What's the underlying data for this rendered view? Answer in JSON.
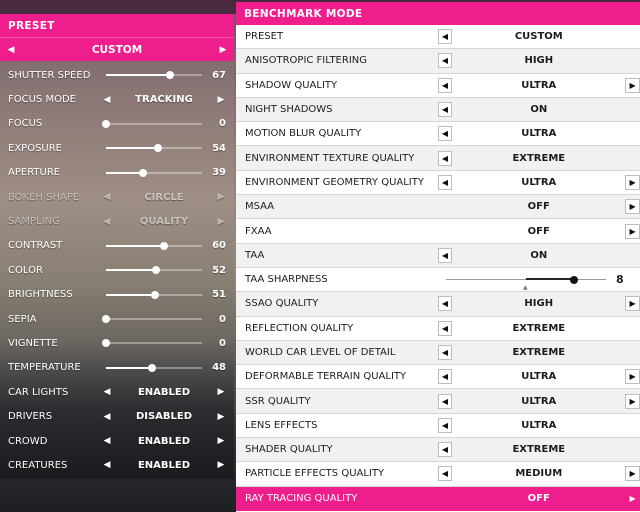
{
  "colors": {
    "accent": "#ee1e8c",
    "panel_bg": "#ffffff",
    "row_alt": "#f1f1f1"
  },
  "photo_panel": {
    "title": "PRESET",
    "preset_value": "CUSTOM",
    "rows": [
      {
        "label": "SHUTTER SPEED",
        "type": "slider",
        "value": "67",
        "level": 0.67
      },
      {
        "label": "FOCUS MODE",
        "type": "choice",
        "value": "TRACKING"
      },
      {
        "label": "FOCUS",
        "type": "slider",
        "value": "0",
        "level": 0.0
      },
      {
        "label": "EXPOSURE",
        "type": "slider",
        "value": "54",
        "level": 0.54
      },
      {
        "label": "APERTURE",
        "type": "slider",
        "value": "39",
        "level": 0.39
      },
      {
        "label": "BOKEH SHAPE",
        "type": "choice",
        "value": "CIRCLE",
        "disabled": true
      },
      {
        "label": "SAMPLING",
        "type": "choice",
        "value": "QUALITY",
        "disabled": true
      },
      {
        "label": "CONTRAST",
        "type": "slider",
        "value": "60",
        "level": 0.6
      },
      {
        "label": "COLOR",
        "type": "slider",
        "value": "52",
        "level": 0.52
      },
      {
        "label": "BRIGHTNESS",
        "type": "slider",
        "value": "51",
        "level": 0.51
      },
      {
        "label": "SEPIA",
        "type": "slider",
        "value": "0",
        "level": 0.0
      },
      {
        "label": "VIGNETTE",
        "type": "slider",
        "value": "0",
        "level": 0.0
      },
      {
        "label": "TEMPERATURE",
        "type": "slider",
        "value": "48",
        "level": 0.48
      },
      {
        "label": "CAR LIGHTS",
        "type": "choice",
        "value": "ENABLED"
      },
      {
        "label": "DRIVERS",
        "type": "choice",
        "value": "DISABLED"
      },
      {
        "label": "CROWD",
        "type": "choice",
        "value": "ENABLED"
      },
      {
        "label": "CREATURES",
        "type": "choice",
        "value": "ENABLED"
      }
    ]
  },
  "benchmark": {
    "title": "BENCHMARK MODE",
    "rows": [
      {
        "label": "PRESET",
        "value": "CUSTOM",
        "left": true,
        "right": false
      },
      {
        "label": "ANISOTROPIC FILTERING",
        "value": "HIGH",
        "left": true,
        "right": false
      },
      {
        "label": "SHADOW QUALITY",
        "value": "ULTRA",
        "left": true,
        "right": true
      },
      {
        "label": "NIGHT SHADOWS",
        "value": "ON",
        "left": true,
        "right": false
      },
      {
        "label": "MOTION BLUR QUALITY",
        "value": "ULTRA",
        "left": true,
        "right": false
      },
      {
        "label": "ENVIRONMENT TEXTURE QUALITY",
        "value": "EXTREME",
        "left": true,
        "right": false
      },
      {
        "label": "ENVIRONMENT GEOMETRY QUALITY",
        "value": "ULTRA",
        "left": true,
        "right": true
      },
      {
        "label": "MSAA",
        "value": "OFF",
        "left": false,
        "right": true
      },
      {
        "label": "FXAA",
        "value": "OFF",
        "left": false,
        "right": true
      },
      {
        "label": "TAA",
        "value": "ON",
        "left": true,
        "right": false
      },
      {
        "label": "TAA SHARPNESS",
        "type": "slider",
        "value": "8",
        "level": 0.8
      },
      {
        "label": "SSAO QUALITY",
        "value": "HIGH",
        "left": true,
        "right": true
      },
      {
        "label": "REFLECTION QUALITY",
        "value": "EXTREME",
        "left": true,
        "right": false
      },
      {
        "label": "WORLD CAR LEVEL OF DETAIL",
        "value": "EXTREME",
        "left": true,
        "right": false
      },
      {
        "label": "DEFORMABLE TERRAIN QUALITY",
        "value": "ULTRA",
        "left": true,
        "right": true
      },
      {
        "label": "SSR QUALITY",
        "value": "ULTRA",
        "left": true,
        "right": true
      },
      {
        "label": "LENS EFFECTS",
        "value": "ULTRA",
        "left": true,
        "right": false
      },
      {
        "label": "SHADER QUALITY",
        "value": "EXTREME",
        "left": true,
        "right": false
      },
      {
        "label": "PARTICLE EFFECTS QUALITY",
        "value": "MEDIUM",
        "left": true,
        "right": true
      },
      {
        "label": "RAY TRACING QUALITY",
        "value": "OFF",
        "left": false,
        "right": true,
        "selected": true
      }
    ]
  }
}
